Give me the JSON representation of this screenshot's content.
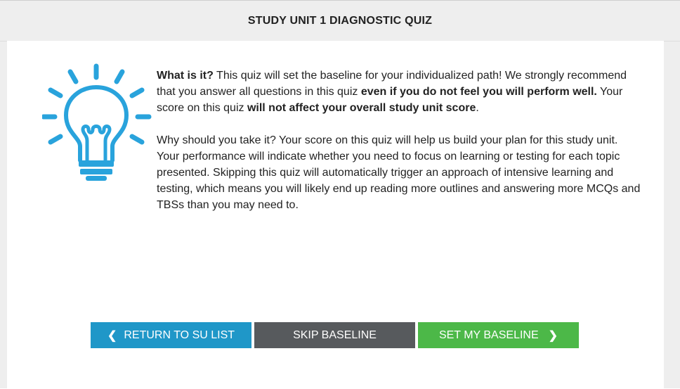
{
  "header": {
    "title": "STUDY UNIT 1 DIAGNOSTIC QUIZ"
  },
  "intro": {
    "p1_lead": "What is it?",
    "p1_a": " This quiz will set the baseline for your individualized path! We strongly recommend that you answer all questions in this quiz ",
    "p1_bold1": "even if you do not feel you will perform well.",
    "p1_b": " Your score on this quiz ",
    "p1_bold2": "will not affect your overall study unit score",
    "p1_end": ".",
    "p2": "Why should you take it? Your score on this quiz will help us build your plan for this study unit. Your performance will indicate whether you need to focus on learning or testing for each topic presented. Skipping this quiz will automatically trigger an approach of intensive learning and testing, which means you will likely end up reading more outlines and answering more MCQs and TBSs than you may need to."
  },
  "buttons": {
    "return_label": "RETURN TO SU LIST",
    "skip_label": "SKIP BASELINE",
    "set_label": "SET MY BASELINE"
  },
  "icons": {
    "hero": "lightbulb-icon",
    "back": "chevron-left-icon",
    "forward": "chevron-right-icon"
  },
  "colors": {
    "icon_blue": "#29a3dc",
    "return_button": "#1f97c8",
    "skip_button": "#575a5d",
    "set_button": "#4cb848"
  }
}
